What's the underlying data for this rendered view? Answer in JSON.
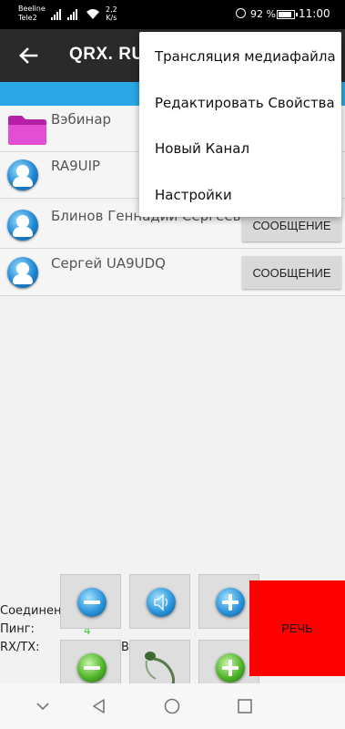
{
  "status": {
    "carrier1": "Beeline",
    "carrier2": "Tele2",
    "net_speed_value": "2,2",
    "net_speed_unit": "K/s",
    "battery_pct": "92 %",
    "battery_level": 0.92,
    "time": "11:00"
  },
  "toolbar": {
    "title": "QRX. RU"
  },
  "list": [
    {
      "name": "Вэбинар",
      "icon": "folder-icon"
    },
    {
      "name": "RA9UIP",
      "icon": "user-avatar-icon"
    },
    {
      "name": "Блинов Геннадий Сергеевич",
      "icon": "user-avatar-icon",
      "button": "СООБЩЕНИЕ"
    },
    {
      "name": "Сергей UA9UDQ",
      "icon": "user-avatar-icon",
      "button": "СООБЩЕНИЕ"
    }
  ],
  "menu": {
    "items": [
      "Трансляция медиафайла",
      "Редактировать Свойства",
      "Новый Канал",
      "Настройки"
    ]
  },
  "info": {
    "connected_label": "Соединен",
    "ping_label": "Пинг:",
    "ping_value": "4",
    "rxtx_label": "RX/TX:",
    "rxtx_value_tail": "B"
  },
  "controls": {
    "speech_label": "РЕЧЬ"
  },
  "colors": {
    "toolbar": "#2a2a2a",
    "accent_bar": "#2aa7e6",
    "speech_button": "#ff0000",
    "ping_value": "#33cc33"
  },
  "navbar": {
    "icons": [
      "chevron-down-icon",
      "back-triangle-icon",
      "home-circle-icon",
      "recents-square-icon"
    ]
  }
}
